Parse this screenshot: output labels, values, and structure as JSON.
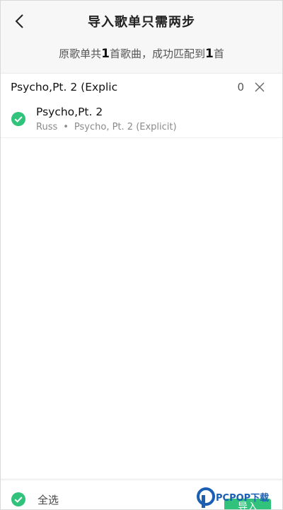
{
  "header": {
    "title": "导入歌单只需两步"
  },
  "summary": {
    "prefix": "原歌单共",
    "total": "1",
    "middle": "首歌曲，成功匹配到",
    "matched": "1",
    "suffix": "首"
  },
  "search": {
    "query": "Psycho,Pt. 2 (Explic",
    "count": "0"
  },
  "songs": [
    {
      "title": "Psycho,Pt. 2",
      "artist": "Russ",
      "separator": "•",
      "album": "Psycho, Pt. 2 (Explicit)",
      "checked": true
    }
  ],
  "bottom": {
    "select_all_label": "全选",
    "import_label": "导入"
  },
  "watermark": {
    "text": "PCPOP下载"
  },
  "colors": {
    "accent": "#31c27c",
    "background": "#f7f7f7"
  },
  "icons": {
    "back": "chevron-left-icon",
    "clear": "close-icon",
    "check": "check-circle-icon"
  }
}
